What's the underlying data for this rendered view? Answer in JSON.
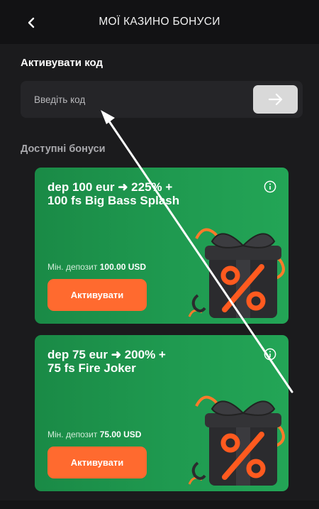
{
  "header": {
    "title": "МОЇ КАЗИНО БОНУСИ",
    "back_icon": "chevron-left-icon"
  },
  "promo": {
    "title": "Активувати код",
    "placeholder": "Введіть код",
    "submit_icon": "arrow-right-icon"
  },
  "bonuses": {
    "title": "Доступні бонуси",
    "items": [
      {
        "title_line1": "dep 100 eur ➜ 225% +",
        "title_line2": "100 fs Big Bass Splash",
        "min_label": "Мін. депозит",
        "min_value": "100.00 USD",
        "button": "Активувати"
      },
      {
        "title_line1": "dep 75 eur ➜ 200% +",
        "title_line2": "75 fs Fire Joker",
        "min_label": "Мін. депозит",
        "min_value": "75.00 USD",
        "button": "Активувати"
      }
    ]
  },
  "colors": {
    "background": "#1b1b1d",
    "card_green": "#1f9a50",
    "activate_orange": "#ff6a2f"
  }
}
